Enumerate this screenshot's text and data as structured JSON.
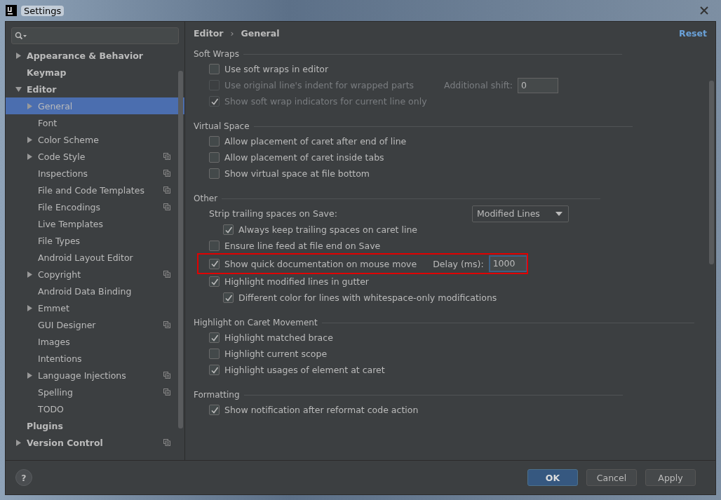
{
  "window": {
    "title": "Settings"
  },
  "sidebar": {
    "items": [
      {
        "label": "Appearance & Behavior",
        "expanded": false,
        "selected": false,
        "shared": false
      },
      {
        "label": "Keymap",
        "selected": false,
        "shared": false
      },
      {
        "label": "Editor",
        "expanded": true,
        "selected": false,
        "shared": false,
        "children": [
          {
            "label": "General",
            "expanded": false,
            "selected": true,
            "shared": false
          },
          {
            "label": "Font",
            "selected": false,
            "shared": false
          },
          {
            "label": "Color Scheme",
            "expanded": false,
            "selected": false,
            "shared": false
          },
          {
            "label": "Code Style",
            "expanded": false,
            "selected": false,
            "shared": true
          },
          {
            "label": "Inspections",
            "selected": false,
            "shared": true
          },
          {
            "label": "File and Code Templates",
            "selected": false,
            "shared": true
          },
          {
            "label": "File Encodings",
            "selected": false,
            "shared": true
          },
          {
            "label": "Live Templates",
            "selected": false,
            "shared": false
          },
          {
            "label": "File Types",
            "selected": false,
            "shared": false
          },
          {
            "label": "Android Layout Editor",
            "selected": false,
            "shared": false
          },
          {
            "label": "Copyright",
            "expanded": false,
            "selected": false,
            "shared": true
          },
          {
            "label": "Android Data Binding",
            "selected": false,
            "shared": false
          },
          {
            "label": "Emmet",
            "expanded": false,
            "selected": false,
            "shared": false
          },
          {
            "label": "GUI Designer",
            "selected": false,
            "shared": true
          },
          {
            "label": "Images",
            "selected": false,
            "shared": false
          },
          {
            "label": "Intentions",
            "selected": false,
            "shared": false
          },
          {
            "label": "Language Injections",
            "expanded": false,
            "selected": false,
            "shared": true
          },
          {
            "label": "Spelling",
            "selected": false,
            "shared": true
          },
          {
            "label": "TODO",
            "selected": false,
            "shared": false
          }
        ]
      },
      {
        "label": "Plugins",
        "selected": false,
        "shared": false
      },
      {
        "label": "Version Control",
        "expanded": false,
        "selected": false,
        "shared": true
      }
    ]
  },
  "breadcrumb": [
    "Editor",
    "General"
  ],
  "breadcrumb_separator": "›",
  "help": "?",
  "reset": "Reset",
  "sections": [
    {
      "title": "Soft Wraps",
      "options": [
        {
          "kind": "checkbox",
          "label": "Use soft wraps in editor",
          "checked": false,
          "disabled": false
        },
        {
          "kind": "checkbox",
          "label": "Use original line's indent for wrapped parts",
          "checked": false,
          "disabled": true,
          "field": {
            "label": "Additional shift:",
            "value": "0",
            "focused": false
          }
        },
        {
          "kind": "checkbox",
          "label": "Show soft wrap indicators for current line only",
          "checked": true,
          "disabled": true
        }
      ]
    },
    {
      "title": "Virtual Space",
      "options": [
        {
          "kind": "checkbox",
          "label": "Allow placement of caret after end of line",
          "checked": false,
          "disabled": false
        },
        {
          "kind": "checkbox",
          "label": "Allow placement of caret inside tabs",
          "checked": false,
          "disabled": false
        },
        {
          "kind": "checkbox",
          "label": "Show virtual space at file bottom",
          "checked": false,
          "disabled": false
        }
      ]
    },
    {
      "title": "Other",
      "options": [
        {
          "kind": "dropdown",
          "label": "Strip trailing spaces on Save:",
          "value": "Modified Lines",
          "children": [
            {
              "kind": "checkbox",
              "label": "Always keep trailing spaces on caret line",
              "checked": true,
              "disabled": false
            }
          ]
        },
        {
          "kind": "checkbox",
          "label": "Ensure line feed at file end on Save",
          "checked": false,
          "disabled": false
        },
        {
          "kind": "checkbox",
          "label": "Show quick documentation on mouse move",
          "checked": true,
          "disabled": false,
          "highlighted": true,
          "field": {
            "label": "Delay (ms):",
            "value": "1000",
            "focused": true
          }
        },
        {
          "kind": "checkbox",
          "label": "Highlight modified lines in gutter",
          "checked": true,
          "disabled": false,
          "children": [
            {
              "kind": "checkbox",
              "label": "Different color for lines with whitespace-only modifications",
              "checked": true,
              "disabled": false
            }
          ]
        }
      ]
    },
    {
      "title": "Highlight on Caret Movement",
      "options": [
        {
          "kind": "checkbox",
          "label": "Highlight matched brace",
          "checked": true,
          "disabled": false
        },
        {
          "kind": "checkbox",
          "label": "Highlight current scope",
          "checked": false,
          "disabled": false
        },
        {
          "kind": "checkbox",
          "label": "Highlight usages of element at caret",
          "checked": true,
          "disabled": false
        }
      ]
    },
    {
      "title": "Formatting",
      "options": [
        {
          "kind": "checkbox",
          "label": "Show notification after reformat code action",
          "checked": true,
          "disabled": false
        }
      ]
    }
  ],
  "buttons": [
    {
      "label": "OK",
      "primary": true
    },
    {
      "label": "Cancel",
      "primary": false
    },
    {
      "label": "Apply",
      "primary": false
    }
  ]
}
